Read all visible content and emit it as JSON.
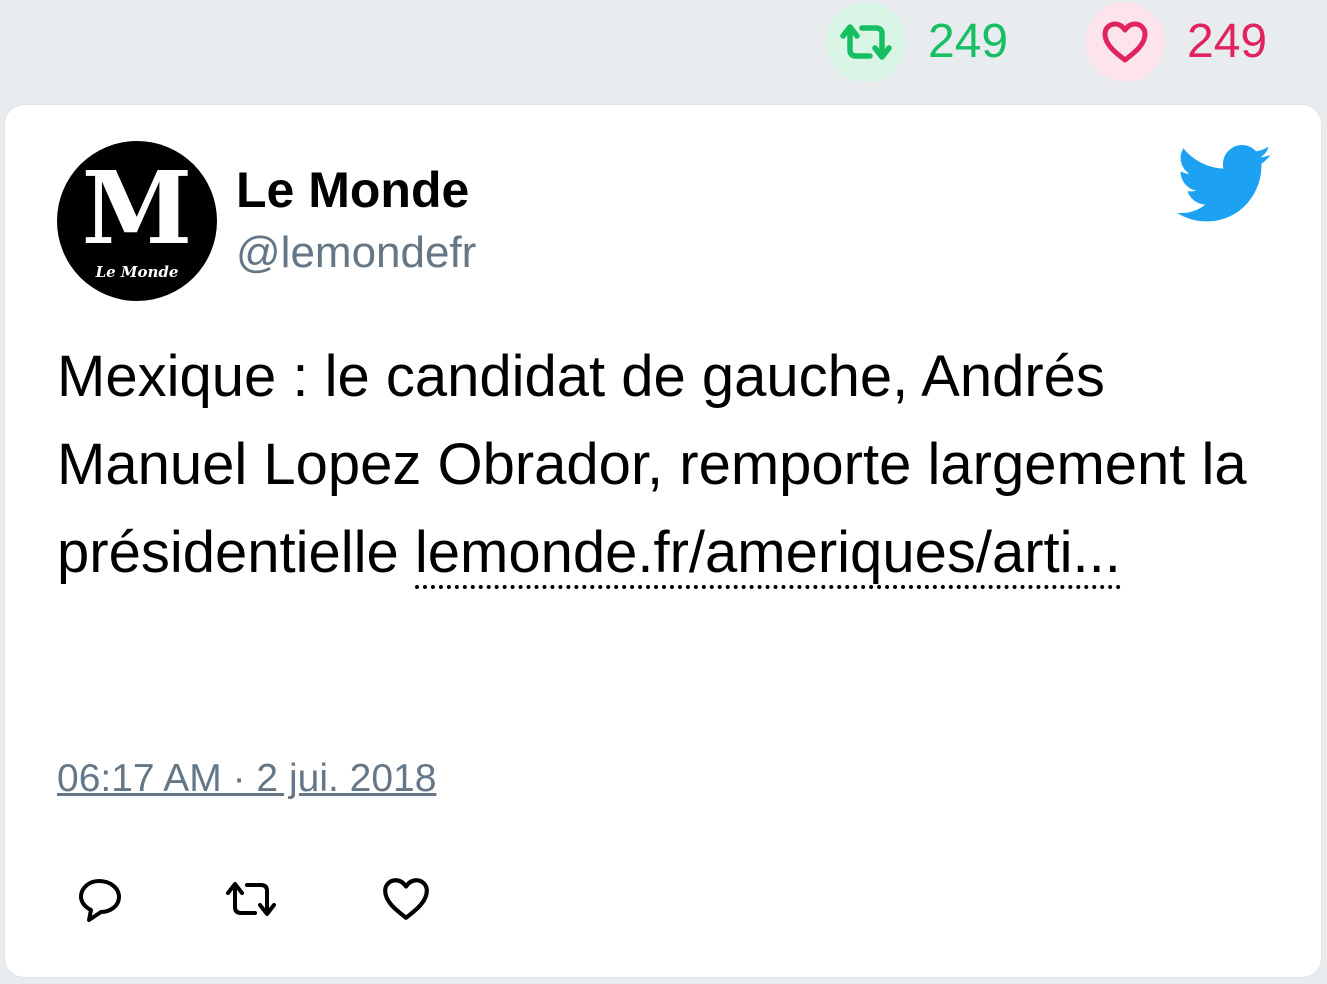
{
  "stats": {
    "retweet_count": "249",
    "like_count": "249",
    "retweet_color": "#17bf63",
    "like_color": "#e0245e"
  },
  "tweet": {
    "author_name": "Le Monde",
    "author_handle": "@lemondefr",
    "avatar_text_large": "M",
    "avatar_text_small": "Le Monde",
    "text": "Mexique : le candidat de gauche, Andrés Manuel Lopez Obrador, remporte largement la présidentielle ",
    "link_text": "lemonde.fr/ameriques/arti...",
    "timestamp": "06:17 AM · 2 jui. 2018"
  },
  "icons": {
    "stats_retweet": "retweet-icon",
    "stats_like": "heart-icon",
    "brand": "twitter-bird-icon",
    "reply": "reply-icon",
    "retweet": "retweet-icon",
    "like": "heart-icon"
  },
  "colors": {
    "brand": "#1da1f2",
    "muted": "#657786"
  }
}
